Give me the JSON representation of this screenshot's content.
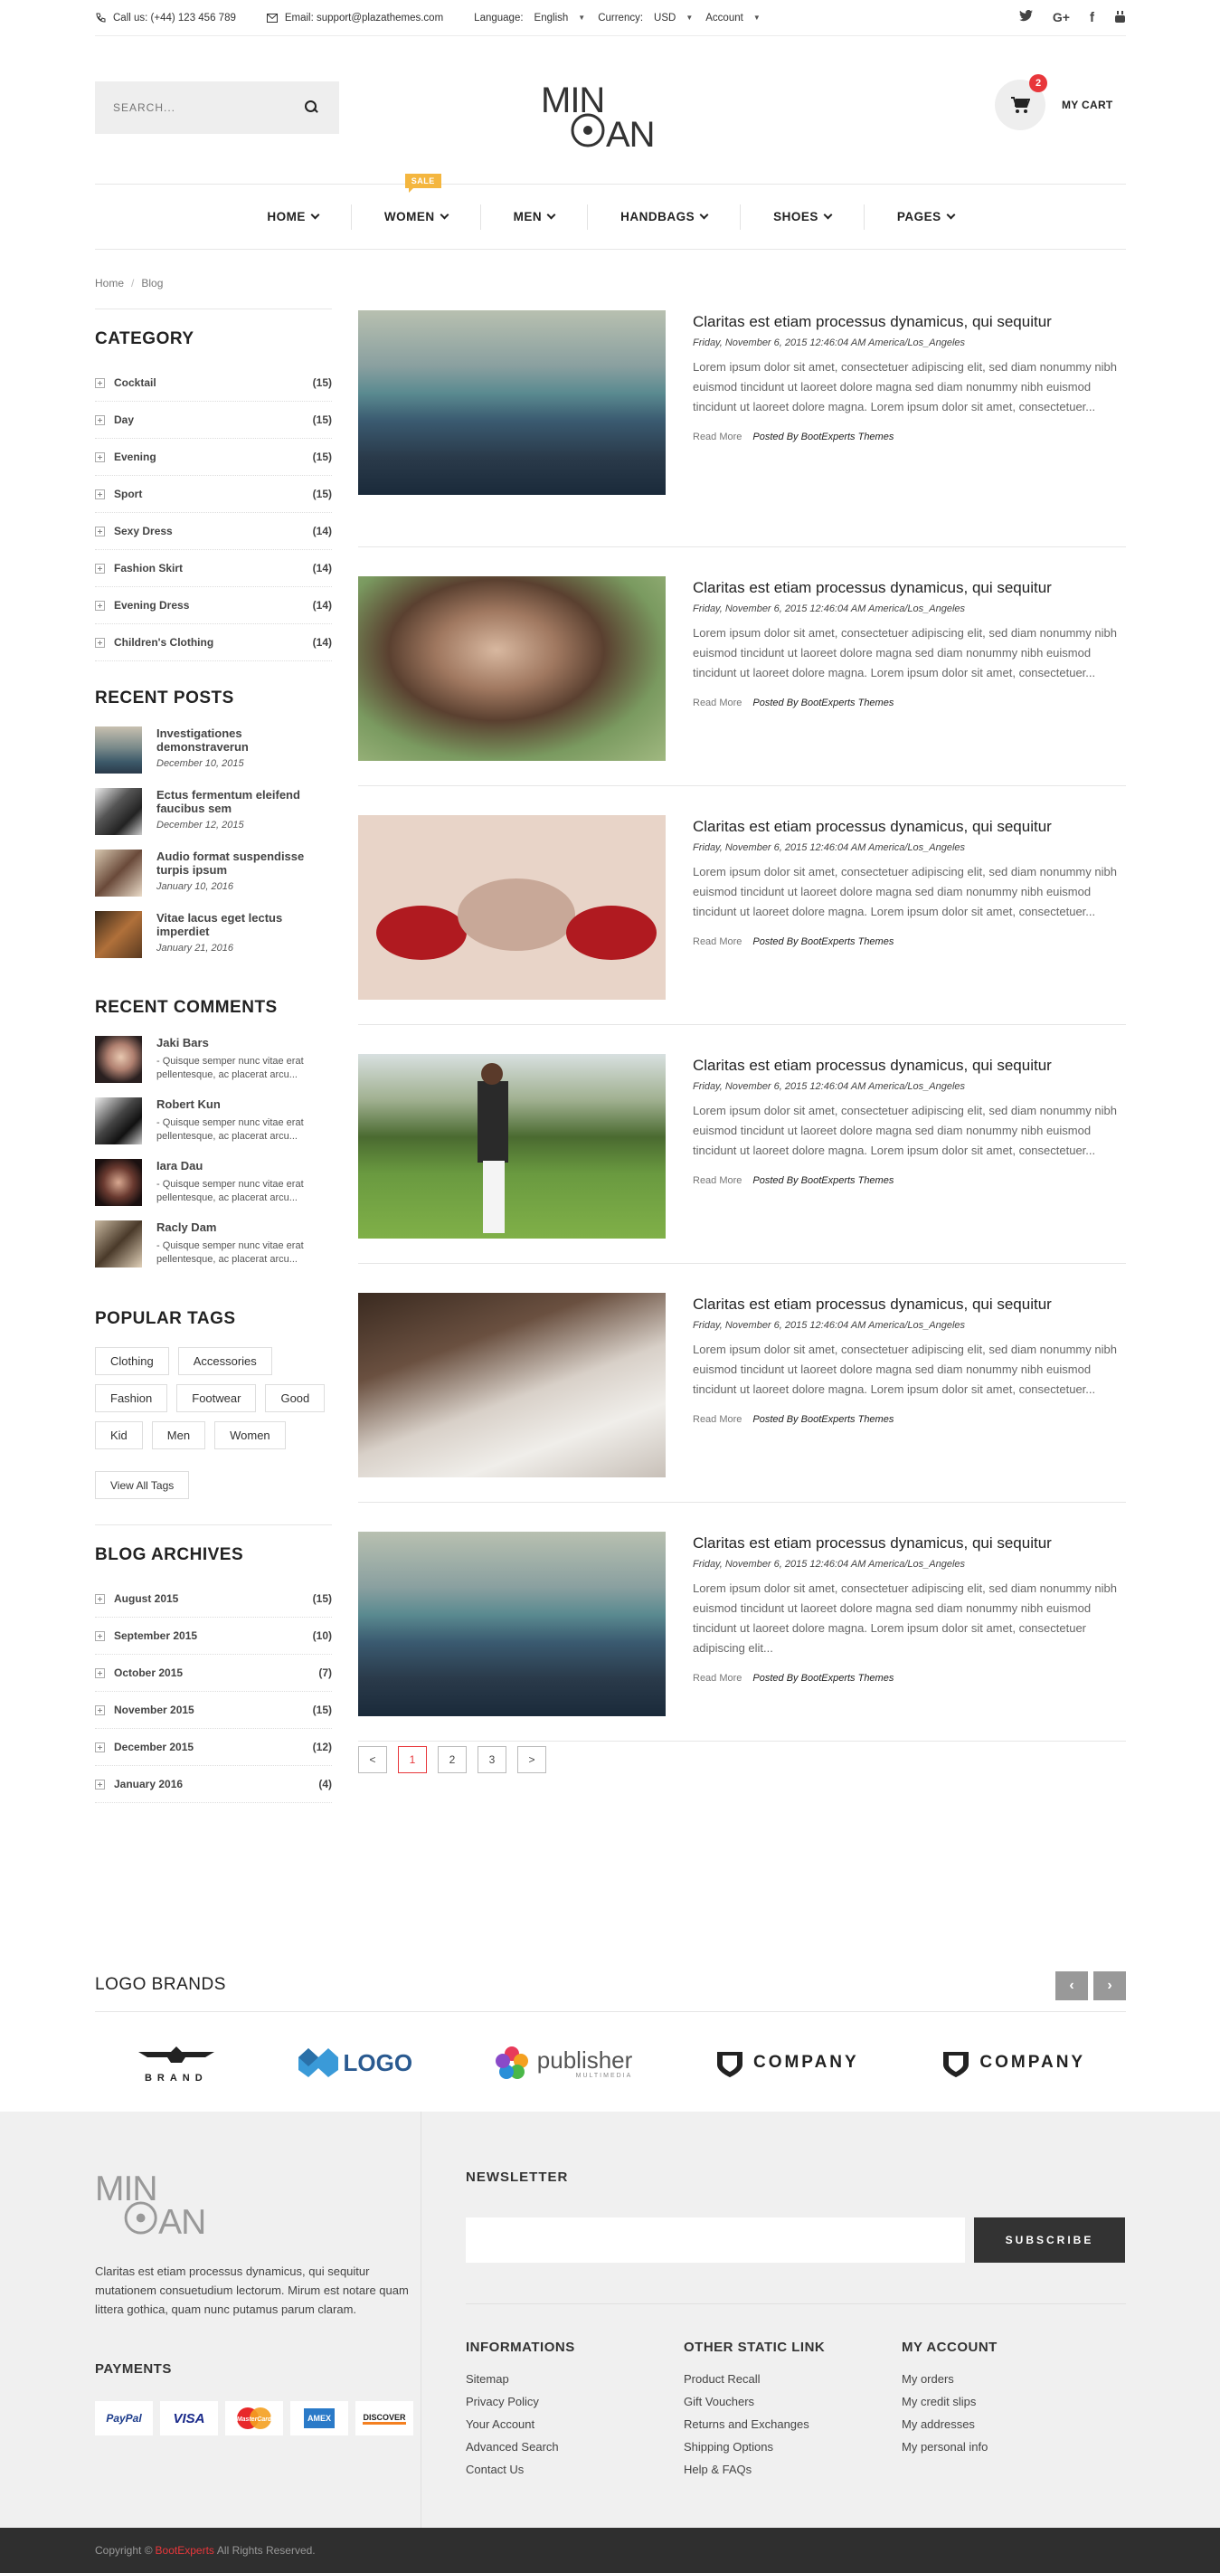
{
  "topbar": {
    "phone": "Call us: (+44) 123 456 789",
    "email": "Email: support@plazathemes.com",
    "language_label": "Language:",
    "language_value": "English",
    "currency_label": "Currency:",
    "currency_value": "USD",
    "account": "Account"
  },
  "header": {
    "search_placeholder": "SEARCH...",
    "logo_text_top": "MIN",
    "logo_text_bottom": "AN",
    "cart_count": "2",
    "cart_label": "MY CART"
  },
  "nav": {
    "items": [
      "HOME",
      "WOMEN",
      "MEN",
      "HANDBAGS",
      "SHOES",
      "PAGES"
    ],
    "sale_badge": "SALE"
  },
  "breadcrumb": {
    "home": "Home",
    "sep": "/",
    "current": "Blog"
  },
  "sidebar": {
    "category_title": "CATEGORY",
    "categories": [
      {
        "name": "Cocktail",
        "count": "(15)"
      },
      {
        "name": "Day",
        "count": "(15)"
      },
      {
        "name": "Evening",
        "count": "(15)"
      },
      {
        "name": "Sport",
        "count": "(15)"
      },
      {
        "name": "Sexy Dress",
        "count": "(14)"
      },
      {
        "name": "Fashion Skirt",
        "count": "(14)"
      },
      {
        "name": "Evening Dress",
        "count": "(14)"
      },
      {
        "name": "Children's Clothing",
        "count": "(14)"
      }
    ],
    "recent_posts_title": "RECENT POSTS",
    "recent_posts": [
      {
        "title": "Investigationes demonstraverun",
        "date": "December 10, 2015"
      },
      {
        "title": "Ectus fermentum eleifend faucibus sem",
        "date": "December 12, 2015"
      },
      {
        "title": "Audio format suspendisse turpis ipsum",
        "date": "January 10, 2016"
      },
      {
        "title": "Vitae lacus eget lectus imperdiet",
        "date": "January 21, 2016"
      }
    ],
    "recent_comments_title": "RECENT COMMENTS",
    "recent_comments": [
      {
        "name": "Jaki Bars",
        "text": "- Quisque semper nunc vitae erat pellentesque, ac placerat arcu..."
      },
      {
        "name": "Robert Kun",
        "text": "- Quisque semper nunc vitae erat pellentesque, ac placerat arcu..."
      },
      {
        "name": "Iara Dau",
        "text": "- Quisque semper nunc vitae erat pellentesque, ac placerat arcu..."
      },
      {
        "name": "Racly Dam",
        "text": "- Quisque semper nunc vitae erat pellentesque, ac placerat arcu..."
      }
    ],
    "tags_title": "POPULAR TAGS",
    "tags": [
      "Clothing",
      "Accessories",
      "Fashion",
      "Footwear",
      "Good",
      "Kid",
      "Men",
      "Women"
    ],
    "view_all_tags": "View All Tags",
    "archives_title": "BLOG ARCHIVES",
    "archives": [
      {
        "name": "August 2015",
        "count": "(15)"
      },
      {
        "name": "September 2015",
        "count": "(10)"
      },
      {
        "name": "October 2015",
        "count": "(7)"
      },
      {
        "name": "November 2015",
        "count": "(15)"
      },
      {
        "name": "December 2015",
        "count": "(12)"
      },
      {
        "name": "January 2016",
        "count": "(4)"
      }
    ]
  },
  "posts": [
    {
      "title": "Claritas est etiam processus dynamicus, qui sequitur",
      "meta": "Friday, November 6, 2015 12:46:04 AM America/Los_Angeles",
      "text": "Lorem ipsum dolor sit amet, consectetuer adipiscing elit, sed diam nonummy nibh euismod tincidunt ut laoreet dolore magna sed diam nonummy nibh euismod tincidunt ut laoreet dolore magna. Lorem ipsum dolor sit amet, consectetuer...",
      "read_more": "Read More",
      "author": "Posted By BootExperts Themes"
    },
    {
      "title": "Claritas est etiam processus dynamicus, qui sequitur",
      "meta": "Friday, November 6, 2015 12:46:04 AM America/Los_Angeles",
      "text": "Lorem ipsum dolor sit amet, consectetuer adipiscing elit, sed diam nonummy nibh euismod tincidunt ut laoreet dolore magna sed diam nonummy nibh euismod tincidunt ut laoreet dolore magna. Lorem ipsum dolor sit amet, consectetuer...",
      "read_more": "Read More",
      "author": "Posted By BootExperts Themes"
    },
    {
      "title": "Claritas est etiam processus dynamicus, qui sequitur",
      "meta": "Friday, November 6, 2015 12:46:04 AM America/Los_Angeles",
      "text": "Lorem ipsum dolor sit amet, consectetuer adipiscing elit, sed diam nonummy nibh euismod tincidunt ut laoreet dolore magna sed diam nonummy nibh euismod tincidunt ut laoreet dolore magna. Lorem ipsum dolor sit amet, consectetuer...",
      "read_more": "Read More",
      "author": "Posted By BootExperts Themes"
    },
    {
      "title": "Claritas est etiam processus dynamicus, qui sequitur",
      "meta": "Friday, November 6, 2015 12:46:04 AM America/Los_Angeles",
      "text": "Lorem ipsum dolor sit amet, consectetuer adipiscing elit, sed diam nonummy nibh euismod tincidunt ut laoreet dolore magna sed diam nonummy nibh euismod tincidunt ut laoreet dolore magna. Lorem ipsum dolor sit amet, consectetuer...",
      "read_more": "Read More",
      "author": "Posted By BootExperts Themes"
    },
    {
      "title": "Claritas est etiam processus dynamicus, qui sequitur",
      "meta": "Friday, November 6, 2015 12:46:04 AM America/Los_Angeles",
      "text": "Lorem ipsum dolor sit amet, consectetuer adipiscing elit, sed diam nonummy nibh euismod tincidunt ut laoreet dolore magna sed diam nonummy nibh euismod tincidunt ut laoreet dolore magna. Lorem ipsum dolor sit amet, consectetuer...",
      "read_more": "Read More",
      "author": "Posted By BootExperts Themes"
    },
    {
      "title": "Claritas est etiam processus dynamicus, qui sequitur",
      "meta": "Friday, November 6, 2015 12:46:04 AM America/Los_Angeles",
      "text": "Lorem ipsum dolor sit amet, consectetuer adipiscing elit, sed diam nonummy nibh euismod tincidunt ut laoreet dolore magna sed diam nonummy nibh euismod tincidunt ut laoreet dolore magna. Lorem ipsum dolor sit amet, consectetuer adipiscing elit...",
      "read_more": "Read More",
      "author": "Posted By BootExperts Themes"
    }
  ],
  "pagination": {
    "prev": "<",
    "pages": [
      "1",
      "2",
      "3"
    ],
    "next": ">"
  },
  "brands": {
    "title": "LOGO BRANDS",
    "prev": "‹",
    "next": "›",
    "items": [
      "BRAND",
      "LOGO",
      "publisher",
      "COMPANY",
      "COMPANY"
    ],
    "publisher_sub": "MULTIMEDIA"
  },
  "footer": {
    "description": "Claritas est etiam processus dynamicus, qui sequitur mutationem consuetudium lectorum. Mirum est notare quam littera gothica, quam nunc putamus parum claram.",
    "payments_title": "PAYMENTS",
    "payments": [
      "PayPal",
      "VISA",
      "MasterCard",
      "AMEX",
      "DISCOVER"
    ],
    "newsletter_title": "NEWSLETTER",
    "subscribe": "SUBSCRIBE",
    "col1_title": "INFORMATIONS",
    "col1": [
      "Sitemap",
      "Privacy Policy",
      "Your Account",
      "Advanced Search",
      "Contact Us"
    ],
    "col2_title": "OTHER STATIC LINK",
    "col2": [
      "Product Recall",
      "Gift Vouchers",
      "Returns and Exchanges",
      "Shipping Options",
      "Help & FAQs"
    ],
    "col3_title": "MY ACCOUNT",
    "col3": [
      "My orders",
      "My credit slips",
      "My addresses",
      "My personal info"
    ]
  },
  "copyright": {
    "prefix": "Copyright ©",
    "brand": "BootExperts",
    "suffix": "All Rights Reserved."
  },
  "colors": {
    "accent": "#e8373b",
    "sale": "#f4b63f",
    "footer_bg": "#f0f0f0",
    "copyright_bg": "#2f2f2f"
  }
}
